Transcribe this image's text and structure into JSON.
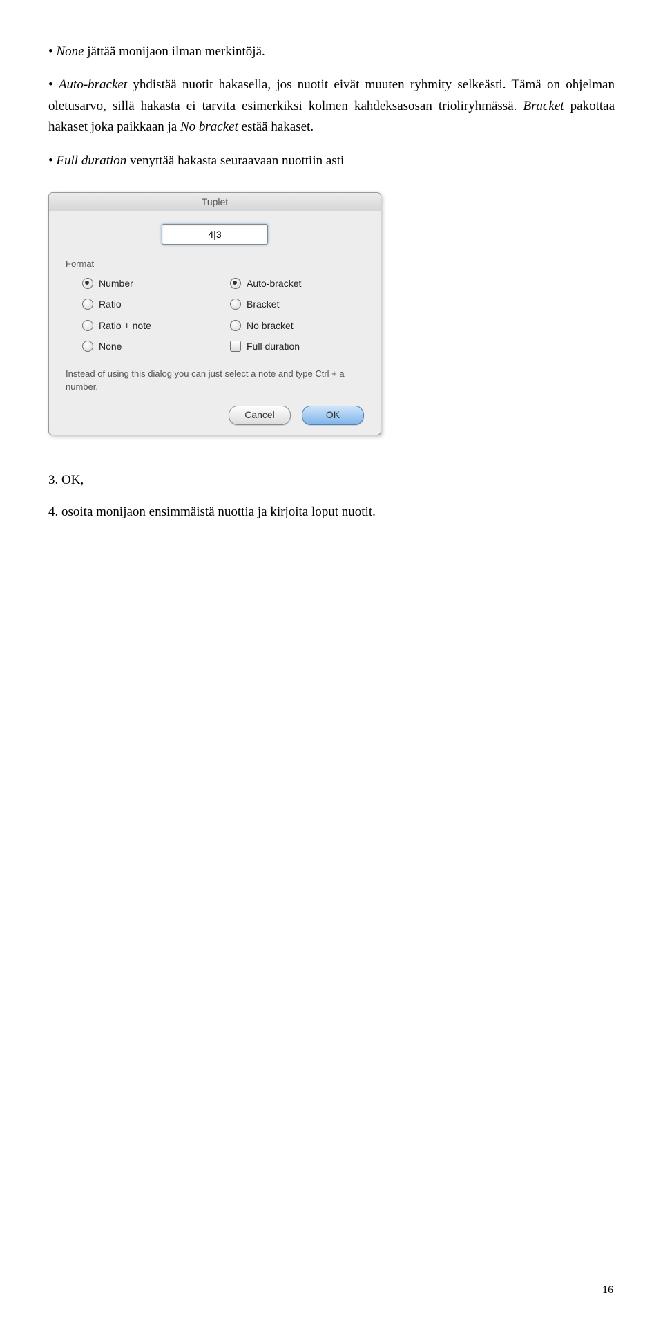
{
  "p1_bullet": "• ",
  "p1_em1": "None",
  "p1_after1": " jättää monijaon ilman merkintöjä.",
  "p2_bullet": "• ",
  "p2_em1": "Auto-bracket",
  "p2_mid1": " yhdistää nuotit hakasella, jos nuotit eivät muuten ryhmity selkeästi. Tämä on ohjelman oletusarvo, sillä hakasta ei tarvita esimerkiksi kolmen kahdeksasosan trioliryhmässä. ",
  "p2_em2": "Bracket",
  "p2_mid2": " pakottaa hakaset joka paikkaan ja ",
  "p2_em3": "No bracket",
  "p2_after3": " estää hakaset.",
  "p3_bullet": "• ",
  "p3_em1": "Full duration",
  "p3_after1": " venyttää hakasta seuraavaan nuottiin asti",
  "dialog": {
    "title": "Tuplet",
    "ratio_value": "4|3",
    "format_label": "Format",
    "opt_number": "Number",
    "opt_ratio": "Ratio",
    "opt_ratio_note": "Ratio + note",
    "opt_none": "None",
    "opt_auto": "Auto-bracket",
    "opt_bracket": "Bracket",
    "opt_nobracket": "No bracket",
    "opt_fulldur": "Full duration",
    "hint": "Instead of using this dialog you can just select a note and type Ctrl + a number.",
    "cancel": "Cancel",
    "ok": "OK"
  },
  "step3": "3. OK,",
  "step4": "4. osoita monijaon ensimmäistä nuottia ja kirjoita loput nuotit.",
  "page_number": "16"
}
